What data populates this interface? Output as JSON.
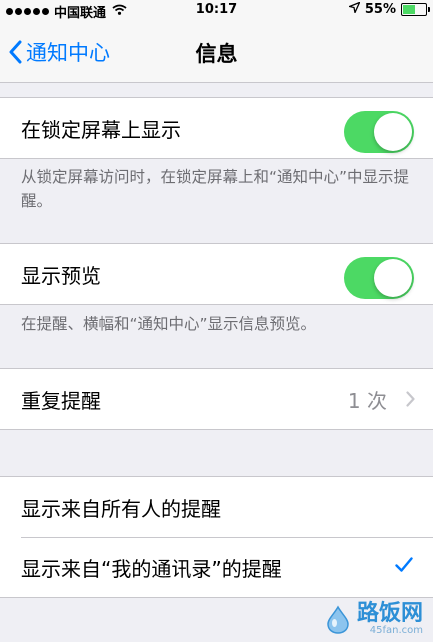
{
  "status_bar": {
    "carrier": "中国联通",
    "time": "10:17",
    "battery": "55%",
    "battery_level": 0.55,
    "accent_color": "#4cd964"
  },
  "navbar": {
    "back_label": "通知中心",
    "title": "信息",
    "tint_color": "#007aff"
  },
  "lock_screen": {
    "label": "在锁定屏幕上显示",
    "enabled": true,
    "footer": "从锁定屏幕访问时，在锁定屏幕上和“通知中心”中显示提醒。"
  },
  "preview": {
    "label": "显示预览",
    "enabled": true,
    "footer": "在提醒、横幅和“通知中心”显示信息预览。"
  },
  "repeat": {
    "label": "重复提醒",
    "value": "1 次"
  },
  "alert_source": {
    "options": [
      {
        "label": "显示来自所有人的提醒",
        "selected": false
      },
      {
        "label": "显示来自“我的通讯录”的提醒",
        "selected": true
      }
    ]
  },
  "watermark": {
    "main": "路饭网",
    "sub": "45fan.com"
  }
}
